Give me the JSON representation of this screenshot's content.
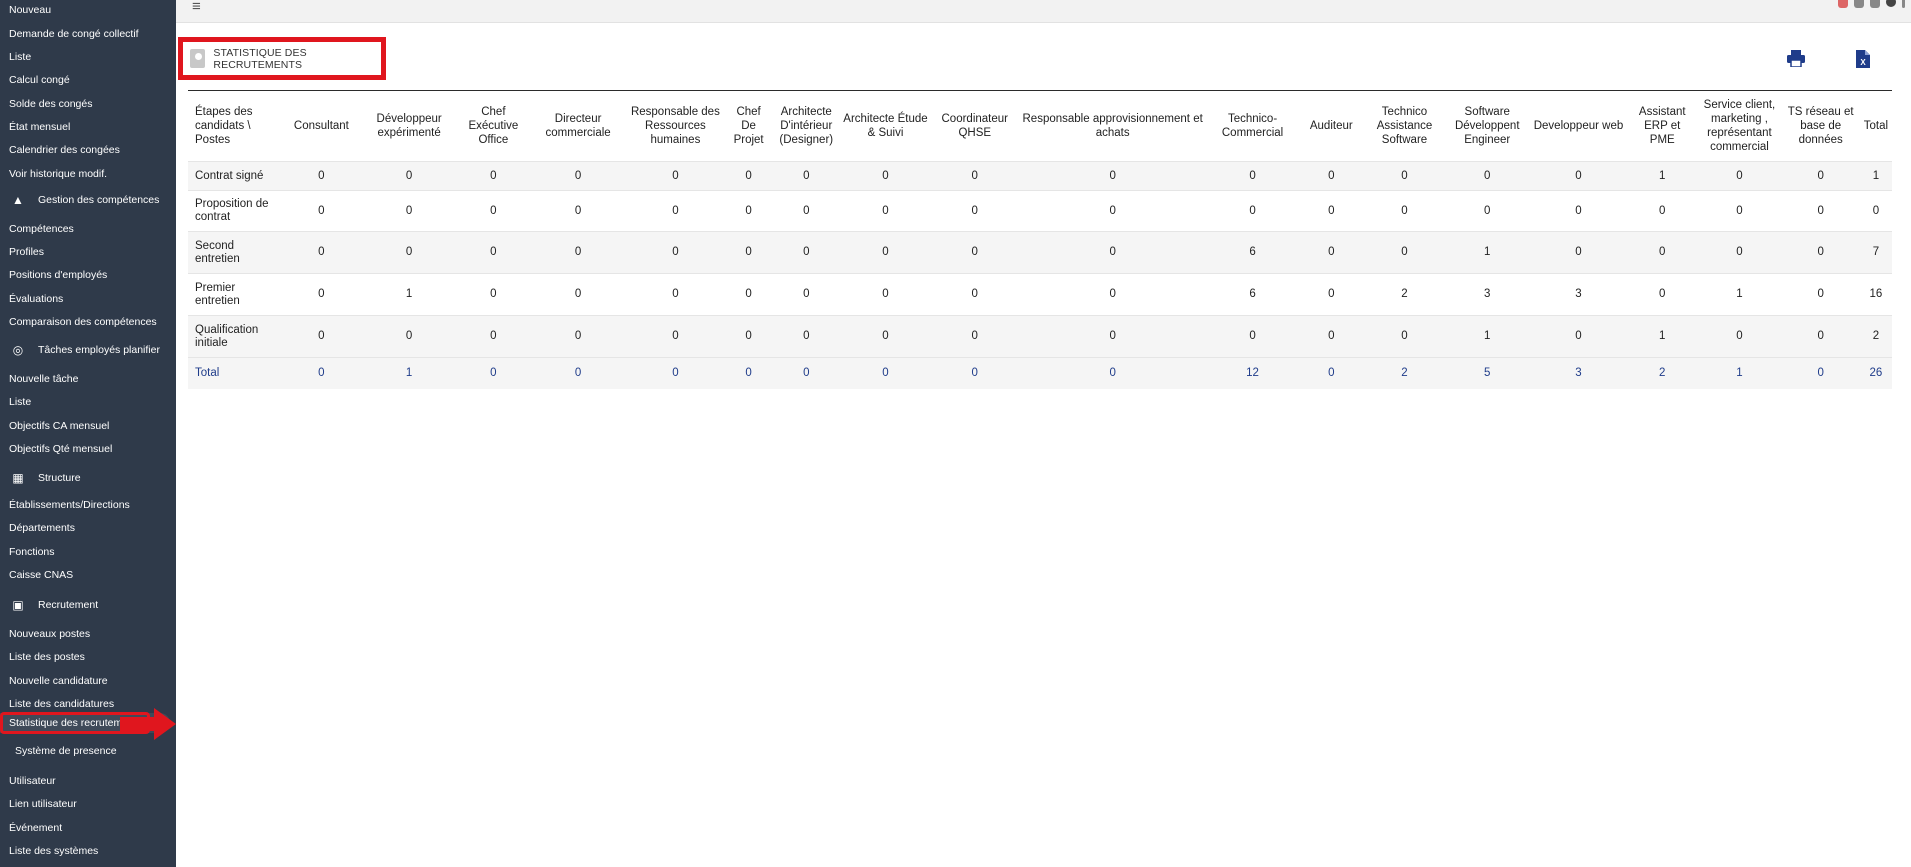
{
  "sidebar": {
    "items": [
      {
        "label": "Nouveau",
        "kind": "item"
      },
      {
        "label": "Demande de congé collectif",
        "kind": "item"
      },
      {
        "label": "Liste",
        "kind": "item"
      },
      {
        "label": "Calcul congé",
        "kind": "item"
      },
      {
        "label": "Solde des congés",
        "kind": "item"
      },
      {
        "label": "État mensuel",
        "kind": "item"
      },
      {
        "label": "Calendrier des congées",
        "kind": "item"
      },
      {
        "label": "Voir historique modif.",
        "kind": "item"
      },
      {
        "label": "Gestion des compétences",
        "kind": "group",
        "icon": "shapes-icon",
        "glyph": "▲"
      },
      {
        "label": "Compétences",
        "kind": "item"
      },
      {
        "label": "Profiles",
        "kind": "item"
      },
      {
        "label": "Positions d'employés",
        "kind": "item"
      },
      {
        "label": "Évaluations",
        "kind": "item"
      },
      {
        "label": "Comparaison des compétences",
        "kind": "item"
      },
      {
        "label": "Tâches employés planifier",
        "kind": "group",
        "icon": "target-icon",
        "glyph": "◎"
      },
      {
        "label": "Nouvelle tâche",
        "kind": "item"
      },
      {
        "label": "Liste",
        "kind": "item"
      },
      {
        "label": "Objectifs CA mensuel",
        "kind": "item"
      },
      {
        "label": "Objectifs Qté mensuel",
        "kind": "item"
      },
      {
        "label": "Structure",
        "kind": "group",
        "icon": "building-icon",
        "glyph": "▦"
      },
      {
        "label": "Établissements/Directions",
        "kind": "item"
      },
      {
        "label": "Départements",
        "kind": "item"
      },
      {
        "label": "Fonctions",
        "kind": "item"
      },
      {
        "label": "Caisse CNAS",
        "kind": "item"
      },
      {
        "label": "Recrutement",
        "kind": "group",
        "icon": "id-badge-icon",
        "glyph": "▣"
      },
      {
        "label": "Nouveaux postes",
        "kind": "item"
      },
      {
        "label": "Liste des postes",
        "kind": "item"
      },
      {
        "label": "Nouvelle candidature",
        "kind": "item"
      },
      {
        "label": "Liste des candidatures",
        "kind": "item"
      },
      {
        "label": "Statistique des recrutements",
        "kind": "active"
      }
    ],
    "system_presence": "Système de presence",
    "bottom_items": [
      "Utilisateur",
      "Lien utilisateur",
      "Événement",
      "Liste des systèmes"
    ]
  },
  "topbar": {
    "menu_glyph": "≡"
  },
  "page": {
    "title": "STATISTIQUE DES RECRUTEMENTS"
  },
  "actions": {
    "print_icon": "print-icon",
    "excel_icon": "excel-export-icon",
    "accent": "#1f3c8a"
  },
  "table": {
    "header_first": "Étapes des candidats \\ Postes",
    "columns": [
      "Consultant",
      "Développeur expérimenté",
      "Chef Exécutive Office",
      "Directeur commerciale",
      "Responsable des Ressources humaines",
      "Chef De Projet",
      "Architecte D'intérieur (Designer)",
      "Architecte Étude & Suivi",
      "Coordinateur QHSE",
      "Responsable approvisionnement et achats",
      "Technico-Commercial",
      "Auditeur",
      "Technico Assistance Software",
      "Software Développent Engineer",
      "Developpeur web",
      "Assistant ERP et PME",
      "Service client, marketing , représentant commercial",
      "TS réseau et base de données",
      "Total"
    ],
    "rows": [
      {
        "stage": "Contrat signé",
        "values": [
          "0",
          "0",
          "0",
          "0",
          "0",
          "0",
          "0",
          "0",
          "0",
          "0",
          "0",
          "0",
          "0",
          "0",
          "0",
          "1",
          "0",
          "0",
          "1"
        ]
      },
      {
        "stage": "Proposition de contrat",
        "values": [
          "0",
          "0",
          "0",
          "0",
          "0",
          "0",
          "0",
          "0",
          "0",
          "0",
          "0",
          "0",
          "0",
          "0",
          "0",
          "0",
          "0",
          "0",
          "0"
        ]
      },
      {
        "stage": "Second entretien",
        "values": [
          "0",
          "0",
          "0",
          "0",
          "0",
          "0",
          "0",
          "0",
          "0",
          "0",
          "6",
          "0",
          "0",
          "1",
          "0",
          "0",
          "0",
          "0",
          "7"
        ]
      },
      {
        "stage": "Premier entretien",
        "values": [
          "0",
          "1",
          "0",
          "0",
          "0",
          "0",
          "0",
          "0",
          "0",
          "0",
          "6",
          "0",
          "2",
          "3",
          "3",
          "0",
          "1",
          "0",
          "16"
        ]
      },
      {
        "stage": "Qualification initiale",
        "values": [
          "0",
          "0",
          "0",
          "0",
          "0",
          "0",
          "0",
          "0",
          "0",
          "0",
          "0",
          "0",
          "0",
          "1",
          "0",
          "1",
          "0",
          "0",
          "2"
        ]
      }
    ],
    "total": {
      "stage": "Total",
      "values": [
        "0",
        "1",
        "0",
        "0",
        "0",
        "0",
        "0",
        "0",
        "0",
        "0",
        "12",
        "0",
        "2",
        "5",
        "3",
        "2",
        "1",
        "0",
        "26"
      ]
    }
  }
}
